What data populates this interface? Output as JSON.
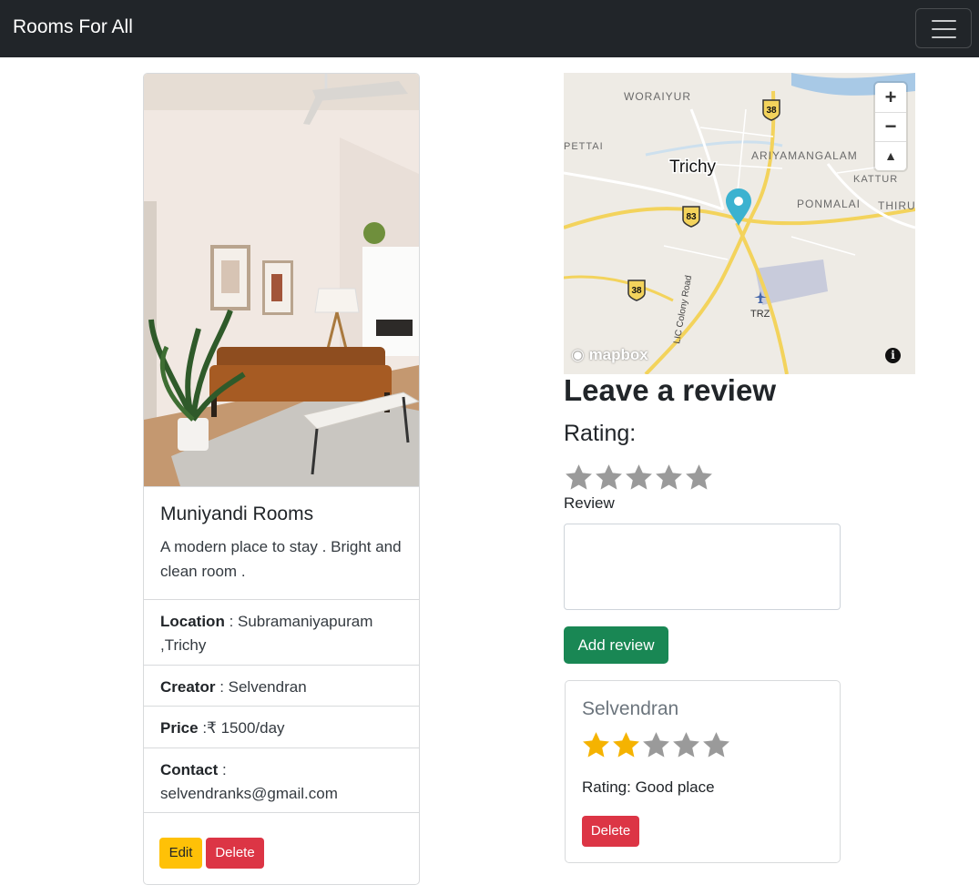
{
  "navbar": {
    "brand": "Rooms For All"
  },
  "listing": {
    "title": "Muniyandi Rooms",
    "description": "A modern place to stay . Bright and clean room .",
    "location_label": "Location",
    "location_value": " : Subramaniyapuram ,Trichy",
    "creator_label": "Creator",
    "creator_value": " : Selvendran",
    "price_label": "Price",
    "price_value": " :₹ 1500/day",
    "contact_label": "Contact",
    "contact_value": " : selvendranks@gmail.com",
    "edit_label": "Edit",
    "delete_label": "Delete"
  },
  "map": {
    "place_labels": [
      "WORAIYUR",
      "PETTAI",
      "Trichy",
      "ARIYAMANGALAM",
      "KATTUR",
      "PONMALAI",
      "THIRU",
      "TRZ",
      "LIC Colony Road"
    ],
    "road_shields": [
      "38",
      "83",
      "38"
    ],
    "zoom_in": "+",
    "zoom_out": "−",
    "compass": "▲",
    "attribution": "mapbox",
    "info": "i"
  },
  "review_form": {
    "heading": "Leave a review",
    "rating_label": "Rating:",
    "rating_value": 0,
    "rating_max": 5,
    "review_label": "Review",
    "review_value": "",
    "submit_label": "Add review"
  },
  "reviews": [
    {
      "author": "Selvendran",
      "rating": 2,
      "rating_max": 5,
      "text": "Rating: Good place",
      "delete_label": "Delete"
    }
  ],
  "colors": {
    "navbar_bg": "#212529",
    "star_filled": "#f5b301",
    "star_empty": "#9a9a9a",
    "success": "#198754",
    "danger": "#dc3545",
    "warning": "#ffc107",
    "map_pin": "#3bb2d0"
  }
}
